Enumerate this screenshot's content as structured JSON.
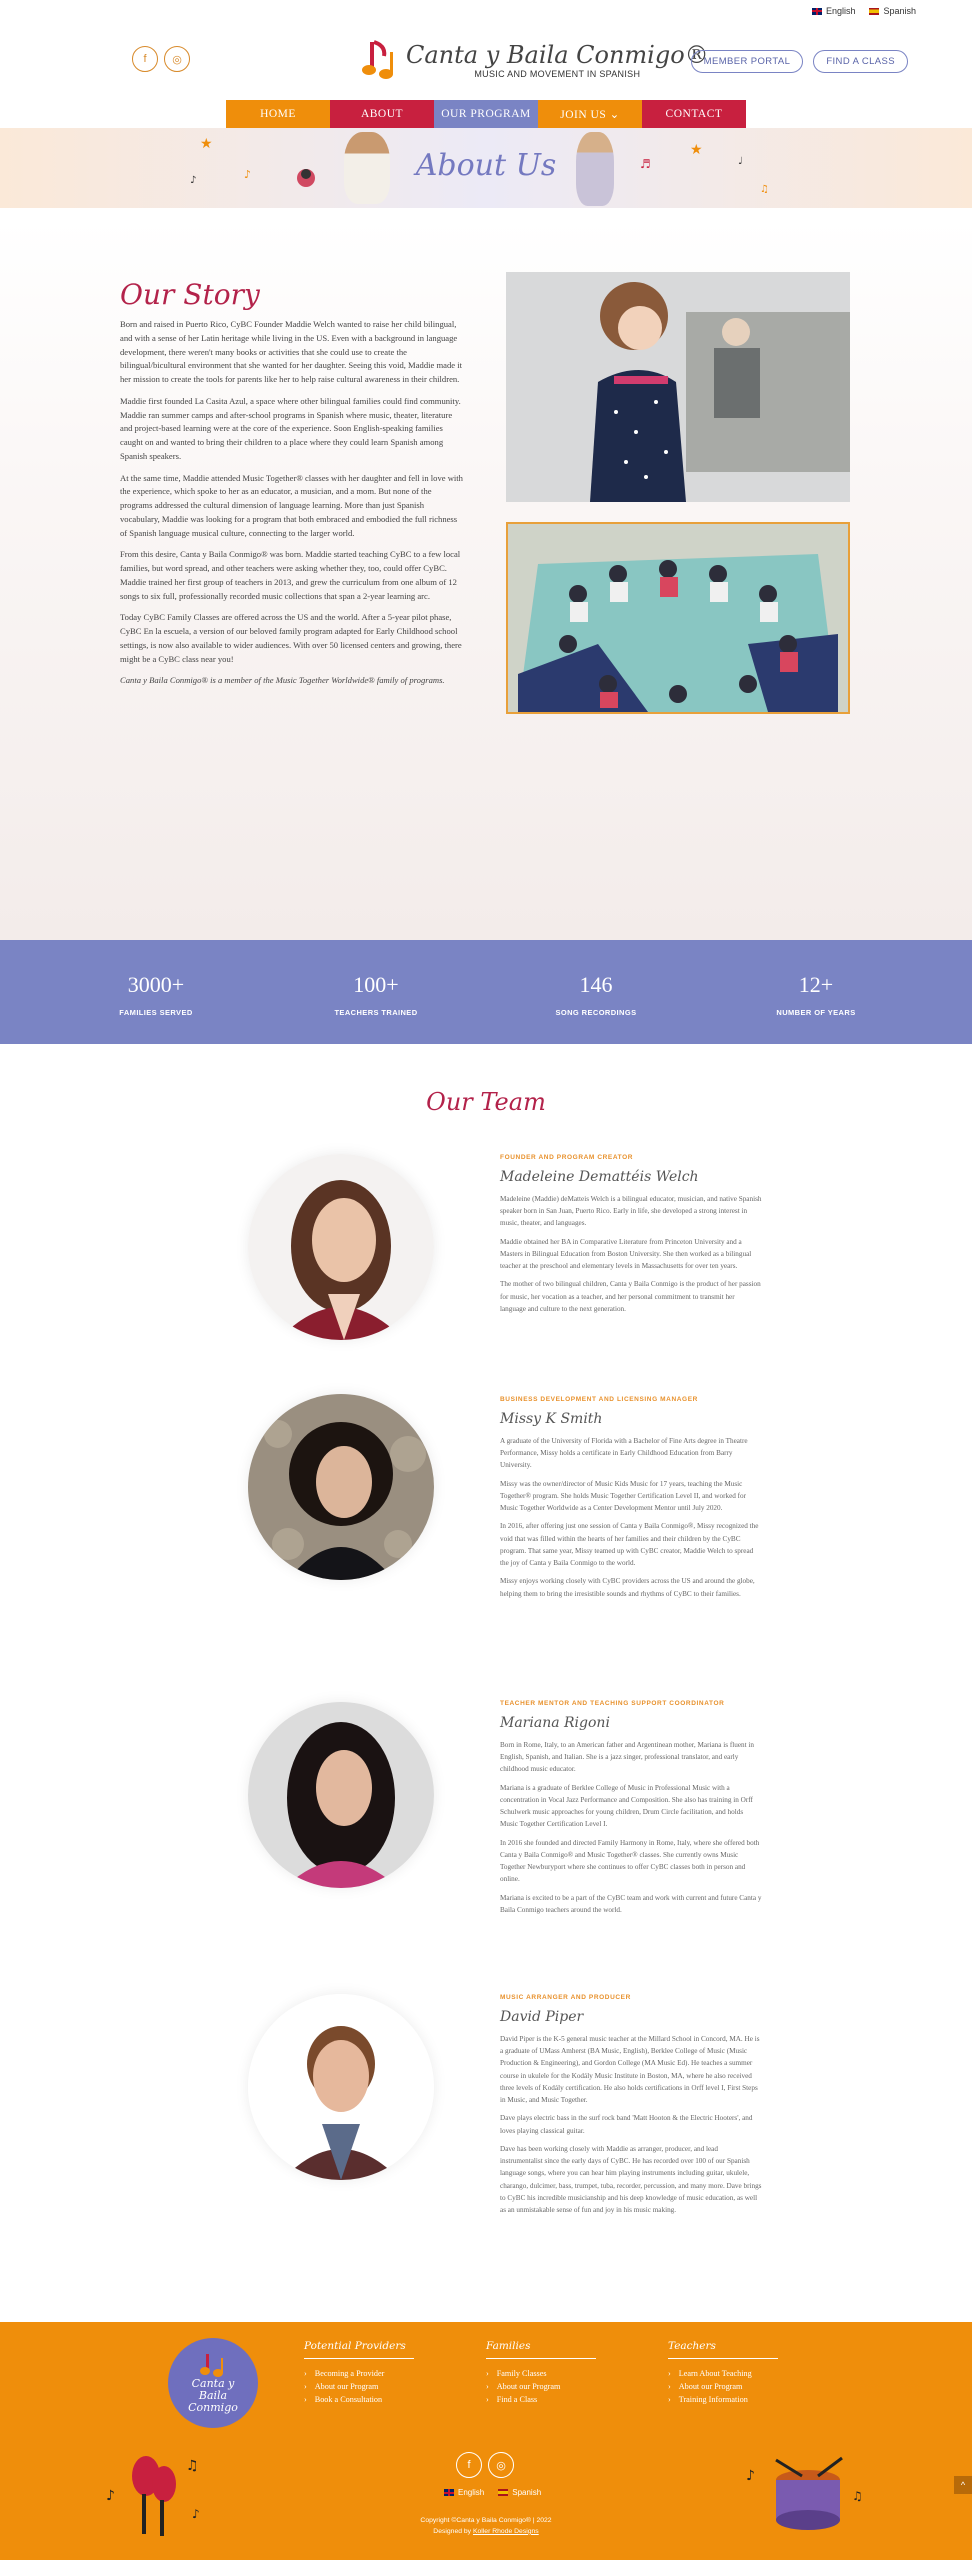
{
  "lang_bar": {
    "english": "English",
    "spanish": "Spanish"
  },
  "header": {
    "logo_title": "Canta y Baila Conmigo®",
    "logo_sub": "MUSIC AND MOVEMENT IN SPANISH",
    "member_portal": "MEMBER PORTAL",
    "find_class": "FIND A CLASS"
  },
  "nav": [
    {
      "label": "HOME",
      "color": "#ef8e0b"
    },
    {
      "label": "ABOUT",
      "color": "#c8203f"
    },
    {
      "label": "OUR PROGRAM",
      "color": "#7a84c4"
    },
    {
      "label": "JOIN US ⌄",
      "color": "#ef8e0b"
    },
    {
      "label": "CONTACT",
      "color": "#c8203f"
    }
  ],
  "banner": {
    "title": "About Us"
  },
  "story": {
    "title": "Our Story",
    "p1": "Born and raised in Puerto Rico, CyBC Founder Maddie Welch wanted to raise her child bilingual, and with a sense of her Latin heritage while living in the US. Even with a background in language development, there weren't many books or activities that she could use to create the bilingual/bicultural environment that she wanted for her daughter. Seeing this void, Maddie made it her mission to create the tools for parents like her to help raise cultural awareness in their children.",
    "p2": "Maddie first founded La Casita Azul, a space where other bilingual families could find community. Maddie ran summer camps and after-school programs in Spanish where music, theater, literature and project-based learning were at the core of the experience. Soon English-speaking families caught on and wanted to bring their children to a place where they could learn Spanish among Spanish speakers.",
    "p3": "At the same time, Maddie attended Music Together® classes with her daughter and fell in love with the experience, which spoke to her as an educator, a musician, and a mom. But none of the programs addressed the cultural dimension of language learning. More than just Spanish vocabulary, Maddie was looking for a program that both embraced and embodied the full richness of Spanish language musical culture, connecting to the larger world.",
    "p4": "From this desire, Canta y Baila Conmigo® was born. Maddie started teaching CyBC to a few local families, but word spread, and other teachers were asking whether they, too, could offer CyBC. Maddie trained her first group of teachers in 2013, and grew the curriculum from one album of 12 songs to six full, professionally recorded music collections that span a 2-year learning arc.",
    "p5": "Today CyBC Family Classes are offered across the US and the world. After a 5-year pilot phase, CyBC En la escuela, a version of our beloved family program adapted for Early Childhood school settings, is now also available to wider audiences. With over 50 licensed centers and growing, there might be a CyBC class near you!",
    "p6": "Canta y Baila Conmigo® is a member of the Music Together Worldwide® family of programs."
  },
  "stats": [
    {
      "number": "3000+",
      "label": "FAMILIES SERVED"
    },
    {
      "number": "100+",
      "label": "TEACHERS TRAINED"
    },
    {
      "number": "146",
      "label": "SONG RECORDINGS"
    },
    {
      "number": "12+",
      "label": "NUMBER OF YEARS"
    }
  ],
  "team": {
    "title": "Our Team",
    "members": [
      {
        "role": "FOUNDER AND PROGRAM CREATOR",
        "name": "Madeleine Demattéis Welch",
        "bio": [
          "Madeleine (Maddie) deMatteis Welch is a bilingual educator, musician, and native Spanish speaker born in San Juan, Puerto Rico. Early in life, she developed a strong interest in music, theater, and languages.",
          "Maddie obtained her BA in Comparative Literature from Princeton University and a Masters in Bilingual Education from Boston University. She then worked as a bilingual teacher at the preschool and elementary levels in Massachusetts for over ten years.",
          "The mother of two bilingual children, Canta y Baila Conmigo is the product of her passion for music, her vocation as a teacher, and her personal commitment to transmit her language and culture to the next generation."
        ]
      },
      {
        "role": "BUSINESS DEVELOPMENT AND LICENSING MANAGER",
        "name": "Missy K Smith",
        "bio": [
          "A graduate of the University of Florida with a Bachelor of Fine Arts degree in Theatre Performance, Missy holds a certificate in Early Childhood Education from Barry University.",
          "Missy was the owner/director of Music Kids Music for 17 years, teaching the Music Together® program. She holds Music Together Certification Level II, and worked for Music Together Worldwide as a Center Development Mentor until July 2020.",
          "In 2016, after offering just one session of Canta y Baila Conmigo®, Missy recognized the void that was filled within the hearts of her families and their children by the CyBC program. That same year, Missy teamed up with CyBC creator, Maddie Welch to spread the joy of Canta y Baila Conmigo to the world.",
          "Missy enjoys working closely with CyBC providers across the US and around the globe, helping them to bring the irresistible sounds and rhythms of CyBC to their families."
        ]
      },
      {
        "role": "TEACHER MENTOR AND TEACHING SUPPORT COORDINATOR",
        "name": "Mariana Rigoni",
        "bio": [
          "Born in Rome, Italy, to an American father and Argentinean mother, Mariana is fluent in English, Spanish, and Italian. She is a jazz singer, professional translator, and early childhood music educator.",
          "Mariana is a graduate of Berklee College of Music in Professional Music with a concentration in Vocal Jazz Performance and Composition. She also has training in Orff Schulwerk music approaches for young children, Drum Circle facilitation, and holds Music Together Certification Level I.",
          "In 2016 she founded and directed Family Harmony in Rome, Italy, where she offered both Canta y Baila Conmigo® and Music Together® classes. She currently owns Music Together Newburyport where she continues to offer CyBC classes both in person and online.",
          "Mariana is excited to be a part of the CyBC team and work with current and future Canta y Baila Conmigo teachers around the world."
        ]
      },
      {
        "role": "MUSIC ARRANGER AND PRODUCER",
        "name": "David Piper",
        "bio": [
          "David Piper is the K-5 general music teacher at the Millard School in Concord, MA. He is a graduate of UMass Amherst (BA Music, English), Berklee College of Music (Music Production & Engineering), and Gordon College (MA Music Ed). He teaches a summer course in ukulele for the Kodály Music Institute in Boston, MA, where he also received three levels of Kodály certification. He also holds certifications in Orff level I, First Steps in Music, and Music Together.",
          "Dave plays electric bass in the surf rock band 'Matt Hooton & the Electric Hooters', and loves playing classical guitar.",
          "Dave has been working closely with Maddie as arranger, producer, and lead instrumentalist since the early days of CyBC. He has recorded over 100 of our Spanish language songs, where you can hear him playing instruments including guitar, ukulele, charango, dulcimer, bass, trumpet, tuba, recorder, percussion, and many more. Dave brings to CyBC his incredible musicianship and his deep knowledge of music education, as well as an unmistakable sense of fun and joy in his music making."
        ]
      }
    ]
  },
  "footer": {
    "logo_text": "Canta y Baila Conmigo",
    "cols": [
      {
        "title": "Potential Providers",
        "items": [
          "Becoming a Provider",
          "About our Program",
          "Book a Consultation"
        ]
      },
      {
        "title": "Families",
        "items": [
          "Family Classes",
          "About our Program",
          "Find a Class"
        ]
      },
      {
        "title": "Teachers",
        "items": [
          "Learn About Teaching",
          "About our Program",
          "Training Information"
        ]
      }
    ],
    "lang_english": "English",
    "lang_spanish": "Spanish",
    "copyright": "Copyright ©Canta y Baila Conmigo® | 2022",
    "designed_prefix": "Designed by ",
    "designed_link": "Koller Rhode Designs"
  },
  "icons": {
    "facebook": "f",
    "instagram": "◎",
    "arrow": "›",
    "up": "^"
  },
  "colors": {
    "orange": "#ef8e0b",
    "red": "#c8203f",
    "purple": "#7a84c4"
  }
}
